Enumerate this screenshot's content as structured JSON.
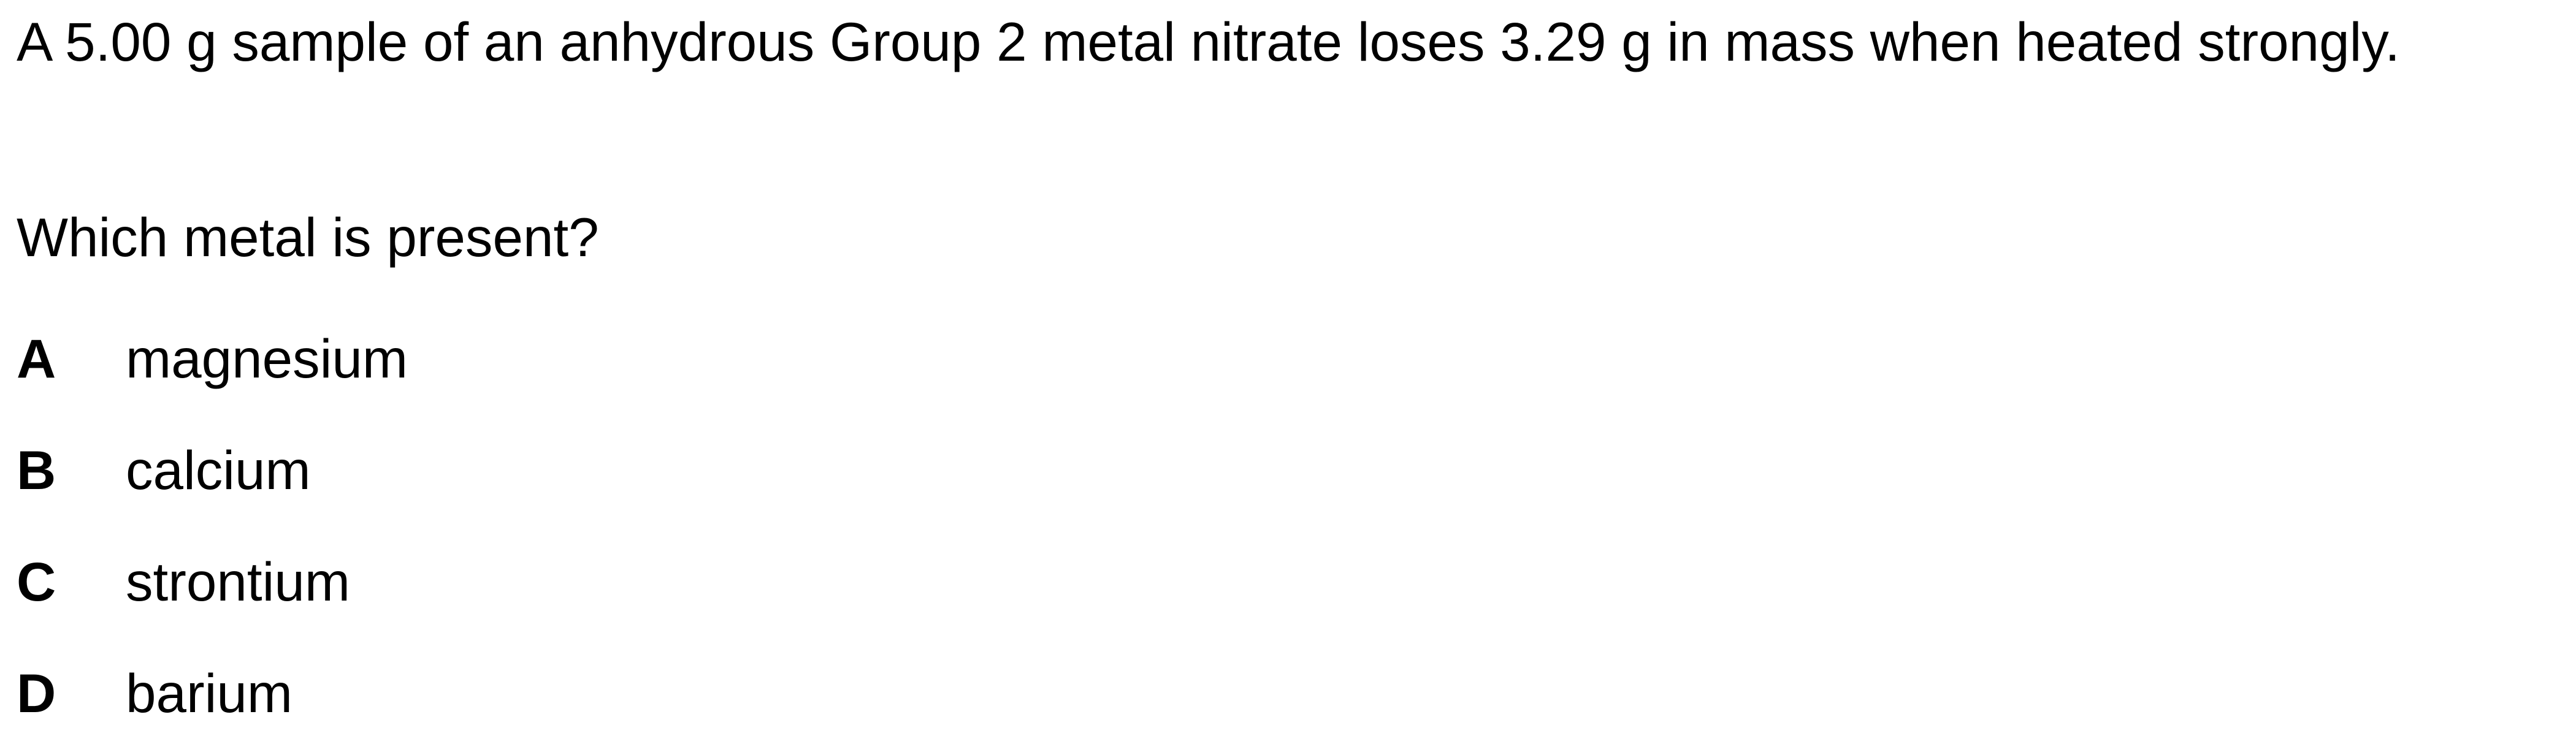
{
  "question": {
    "stem": "A 5.00 g sample of an anhydrous Group 2 metal nitrate loses 3.29 g in mass when heated strongly.",
    "prompt": "Which metal is present?"
  },
  "options": [
    {
      "letter": "A",
      "text": "magnesium"
    },
    {
      "letter": "B",
      "text": "calcium"
    },
    {
      "letter": "C",
      "text": "strontium"
    },
    {
      "letter": "D",
      "text": "barium"
    }
  ]
}
